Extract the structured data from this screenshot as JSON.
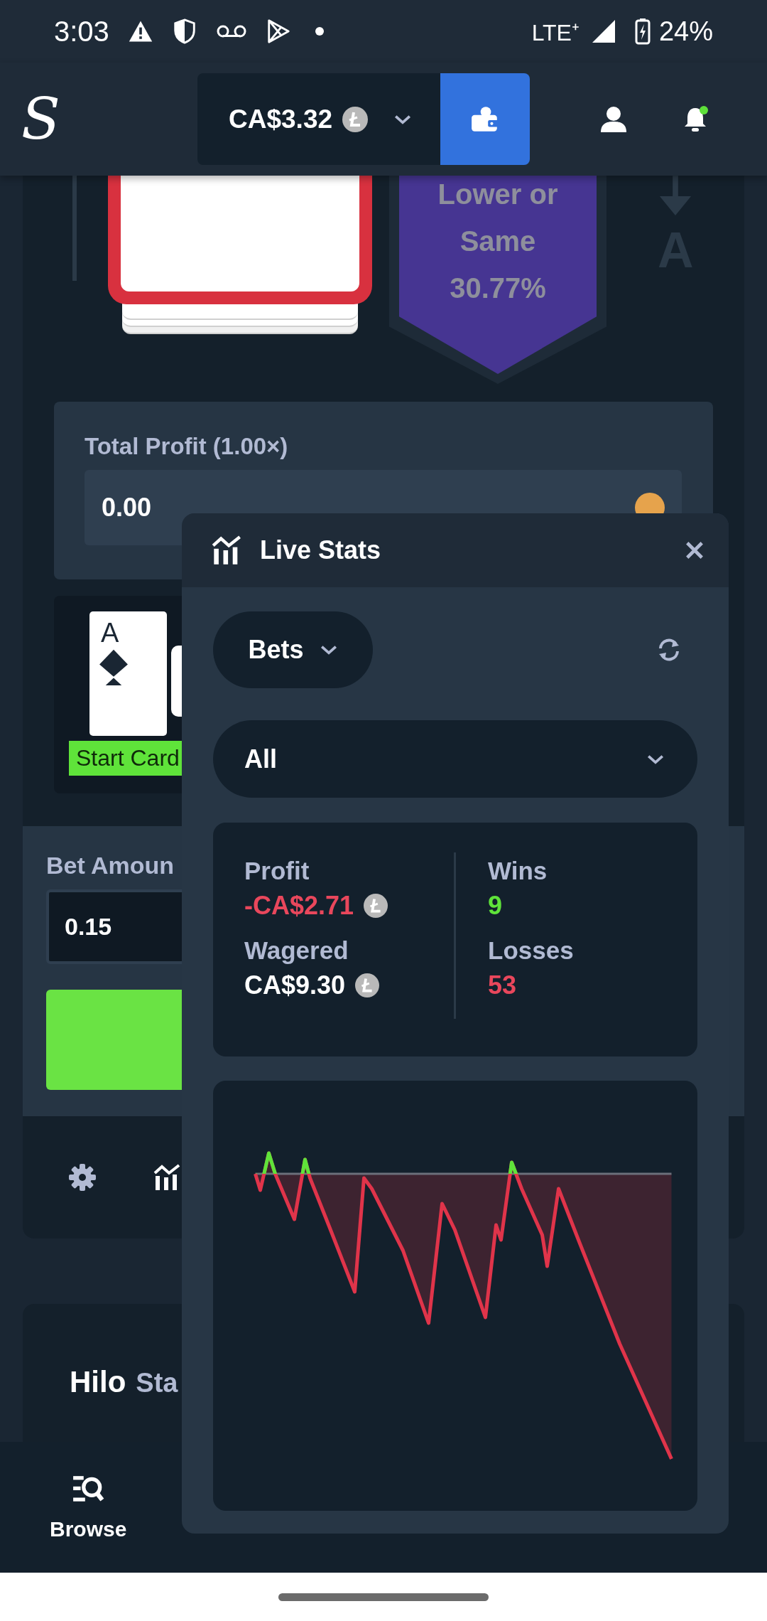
{
  "status_bar": {
    "time": "3:03",
    "network": "LTE⁺",
    "battery": "24%"
  },
  "header": {
    "logo": "S",
    "balance": "CA$3.32",
    "has_notification": true
  },
  "game": {
    "prediction": [
      "Lower or",
      "Same",
      "30.77%"
    ],
    "next_card": "A",
    "total_profit": {
      "label": "Total Profit (1.00×)",
      "value": "0.00"
    },
    "history": [
      {
        "rank": "A",
        "label": "Start Card"
      }
    ]
  },
  "bet": {
    "label": "Bet Amoun",
    "value": "0.15"
  },
  "stats_section": {
    "title": "Hilo",
    "tab": "Sta"
  },
  "nav": [
    {
      "label": "Browse",
      "selected": true
    }
  ],
  "live_stats": {
    "title": "Live Stats",
    "type_filter": "Bets",
    "range_filter": "All",
    "columns": [
      [
        {
          "label": "Profit",
          "value": "-CA$2.71",
          "color": "#e9475c",
          "coin": true
        },
        {
          "label": "Wagered",
          "value": "CA$9.30",
          "color": "#ffffff",
          "coin": true
        }
      ],
      [
        {
          "label": "Wins",
          "value": "9",
          "color": "#5fe33a",
          "coin": false
        },
        {
          "label": "Losses",
          "value": "53",
          "color": "#e9475c",
          "coin": false
        }
      ]
    ]
  }
}
